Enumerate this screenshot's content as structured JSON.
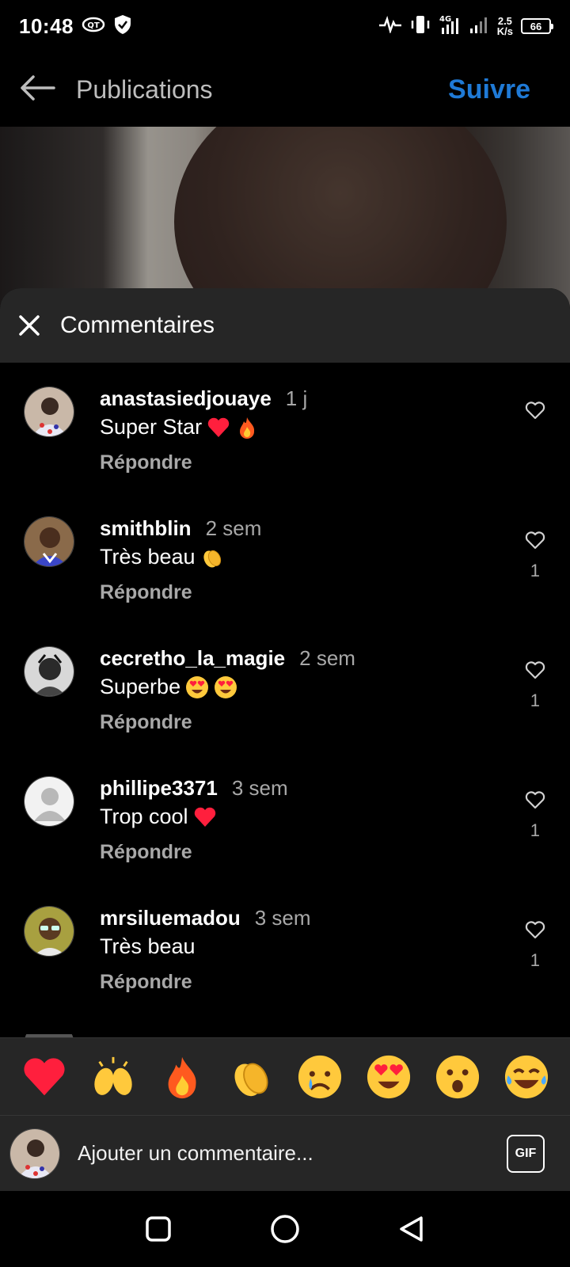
{
  "status_bar": {
    "time": "10:48",
    "net_speed_value": "2.5",
    "net_speed_unit": "K/s",
    "battery": "66",
    "network": "4G",
    "icons": [
      "data-saver-icon",
      "shield-check-icon",
      "activity-icon",
      "vibrate-icon",
      "signal-4g-icon",
      "signal-icon",
      "battery-icon"
    ]
  },
  "header": {
    "title": "Publications",
    "follow_label": "Suivre",
    "back_icon": "arrow-left-icon"
  },
  "sheet": {
    "title": "Commentaires",
    "close_icon": "close-icon"
  },
  "comments": [
    {
      "username": "anastasiedjouaye",
      "time": "1 j",
      "text": "Super Star",
      "emojis": [
        "red-heart",
        "fire"
      ],
      "likes": "",
      "reply_label": "Répondre"
    },
    {
      "username": "smithblin",
      "time": "2 sem",
      "text": "Très beau",
      "emojis": [
        "clapping-hands"
      ],
      "likes": "1",
      "reply_label": "Répondre"
    },
    {
      "username": "cecretho_la_magie",
      "time": "2 sem",
      "text": "Superbe",
      "emojis": [
        "heart-eyes",
        "heart-eyes"
      ],
      "likes": "1",
      "reply_label": "Répondre"
    },
    {
      "username": "phillipe3371",
      "time": "3 sem",
      "text": "Trop cool",
      "emojis": [
        "red-heart"
      ],
      "likes": "1",
      "reply_label": "Répondre"
    },
    {
      "username": "mrsiluemadou",
      "time": "3 sem",
      "text": "Très beau",
      "emojis": [],
      "likes": "1",
      "reply_label": "Répondre"
    }
  ],
  "emoji_bar": [
    "red-heart",
    "raising-hands",
    "fire",
    "clapping-hands",
    "crying-face",
    "heart-eyes",
    "surprised-face",
    "tears-of-joy"
  ],
  "composer": {
    "placeholder": "Ajouter un commentaire...",
    "gif_label": "GIF"
  },
  "nav": [
    "recents-square-icon",
    "home-circle-icon",
    "back-triangle-icon"
  ],
  "colors": {
    "accent": "#1f7ad6",
    "sheet_bg": "#262626",
    "muted": "#a8a8a8",
    "heart": "#ff1f3d"
  }
}
